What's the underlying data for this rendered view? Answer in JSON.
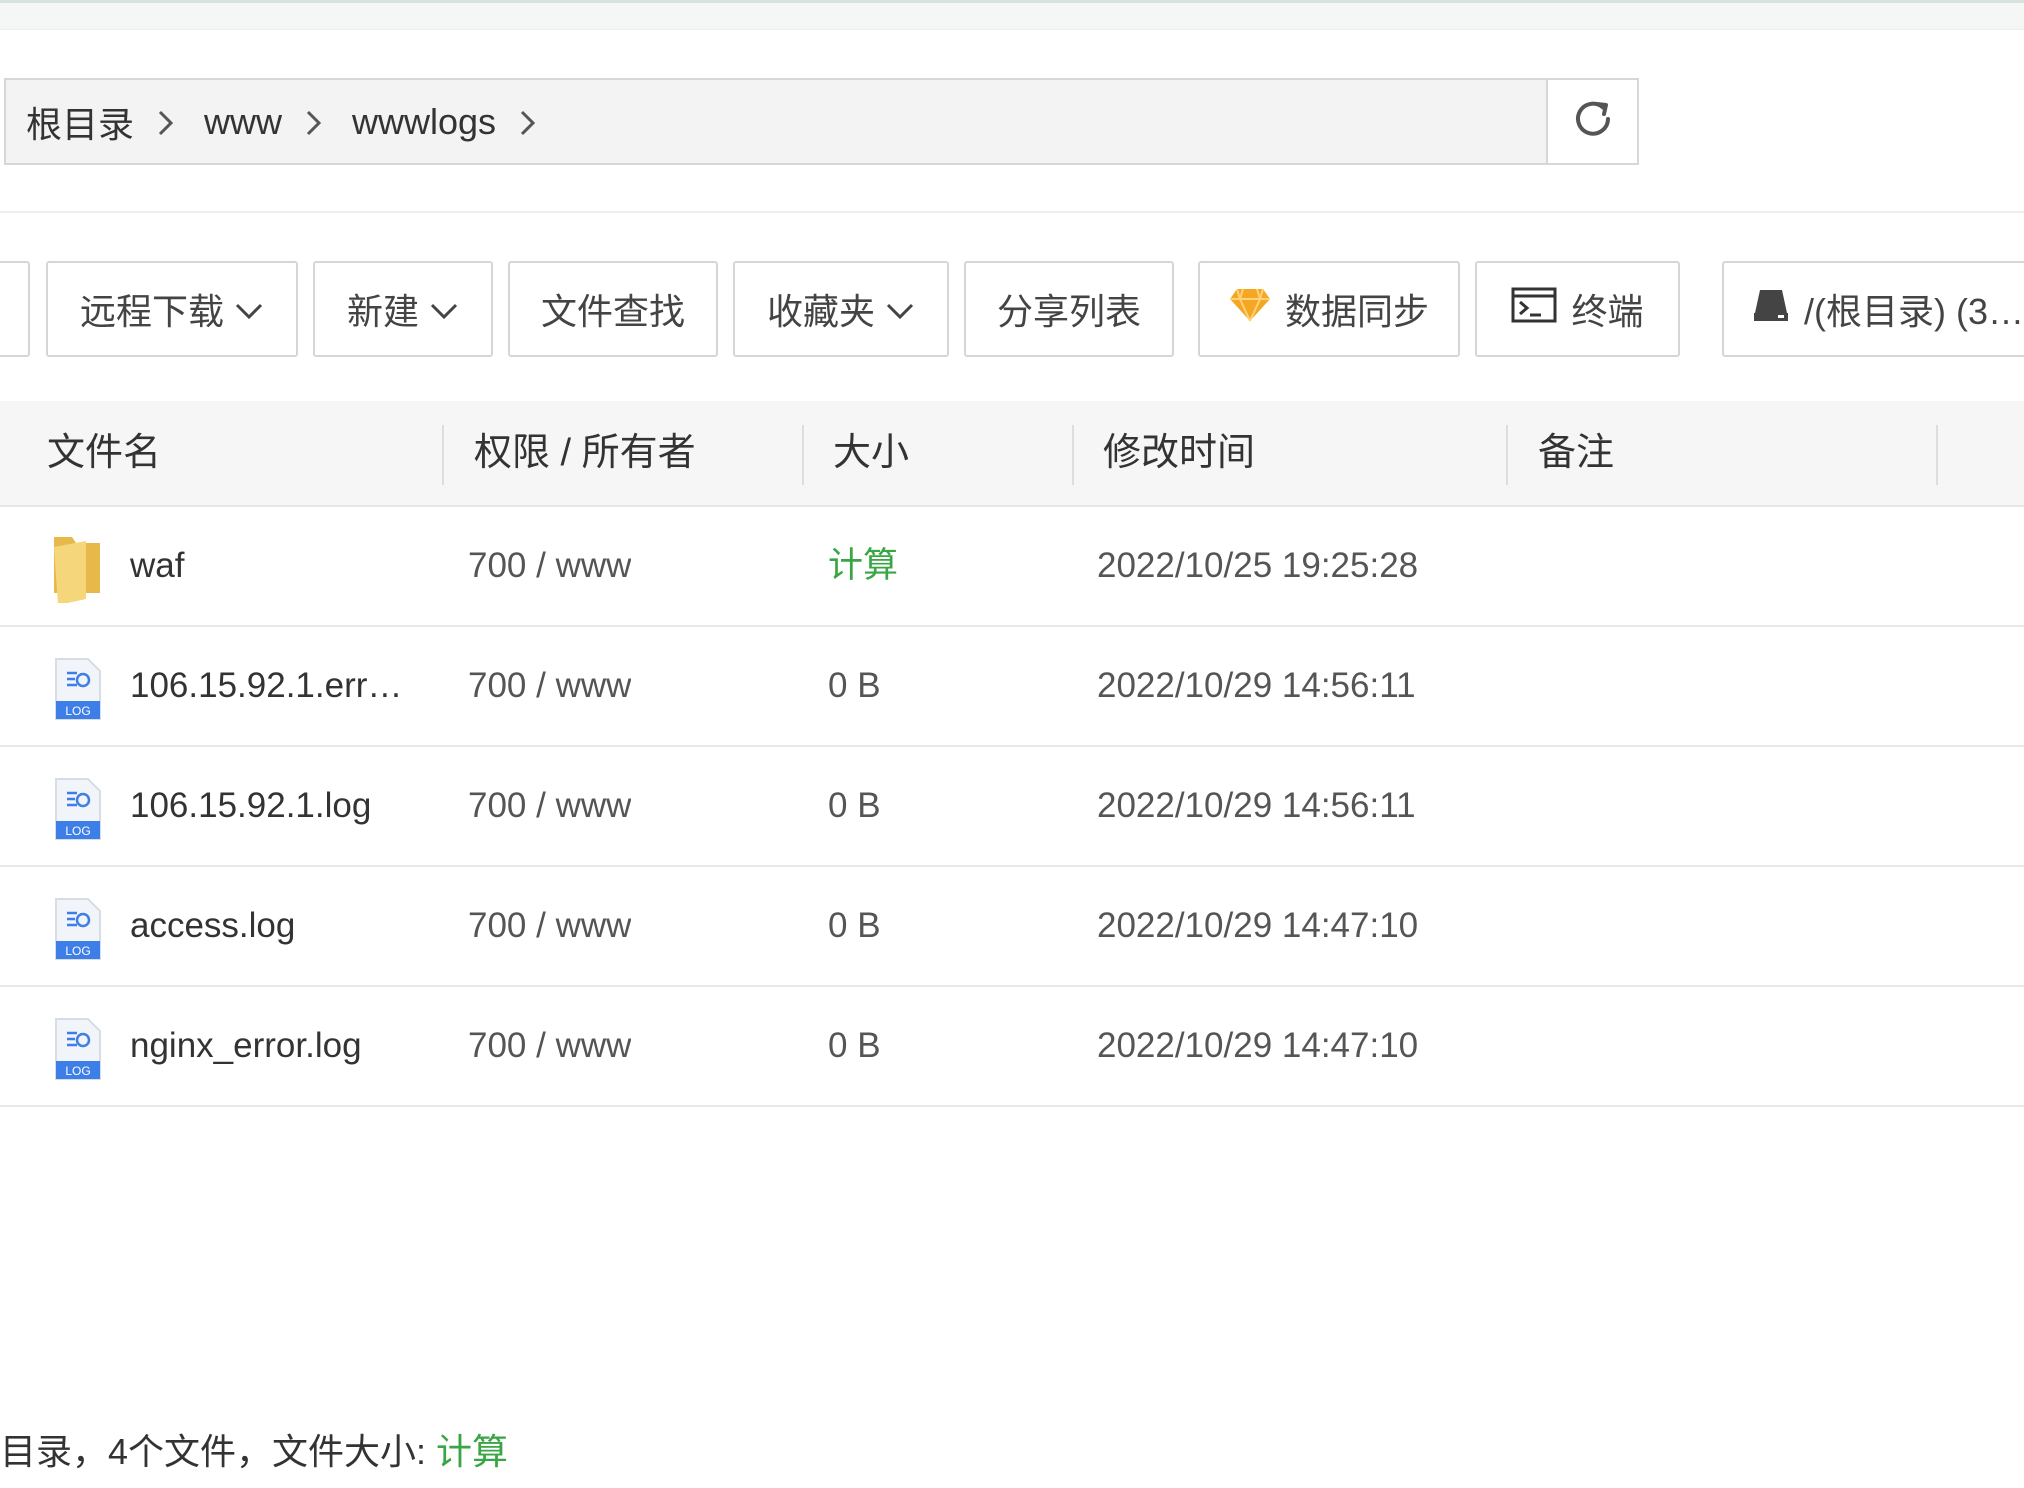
{
  "breadcrumb": {
    "items": [
      "根目录",
      "www",
      "wwwlogs"
    ]
  },
  "toolbar": {
    "remote_download": "远程下载",
    "new": "新建",
    "file_search": "文件查找",
    "favorites": "收藏夹",
    "share_list": "分享列表",
    "data_sync": "数据同步",
    "terminal": "终端",
    "disk": "/(根目录) (3…"
  },
  "table": {
    "headers": {
      "name": "文件名",
      "perm": "权限 / 所有者",
      "size": "大小",
      "mtime": "修改时间",
      "note": "备注"
    },
    "rows": [
      {
        "type": "folder",
        "name": "waf",
        "perm": "700 / www",
        "size": "计算",
        "mtime": "2022/10/25 19:25:28"
      },
      {
        "type": "log",
        "name": "106.15.92.1.err…",
        "perm": "700 / www",
        "size": "0 B",
        "mtime": "2022/10/29 14:56:11"
      },
      {
        "type": "log",
        "name": "106.15.92.1.log",
        "perm": "700 / www",
        "size": "0 B",
        "mtime": "2022/10/29 14:56:11"
      },
      {
        "type": "log",
        "name": "access.log",
        "perm": "700 / www",
        "size": "0 B",
        "mtime": "2022/10/29 14:47:10"
      },
      {
        "type": "log",
        "name": "nginx_error.log",
        "perm": "700 / www",
        "size": "0 B",
        "mtime": "2022/10/29 14:47:10"
      }
    ],
    "icon_label": "LOG"
  },
  "footer": {
    "summary": "目录，4个文件，文件大小:",
    "calc": "计算"
  },
  "colors": {
    "calc_green": "#3aa544",
    "diamond_orange": "#f5a623",
    "log_blue": "#3d7ee8",
    "folder_yellow": "#f3d06a"
  }
}
